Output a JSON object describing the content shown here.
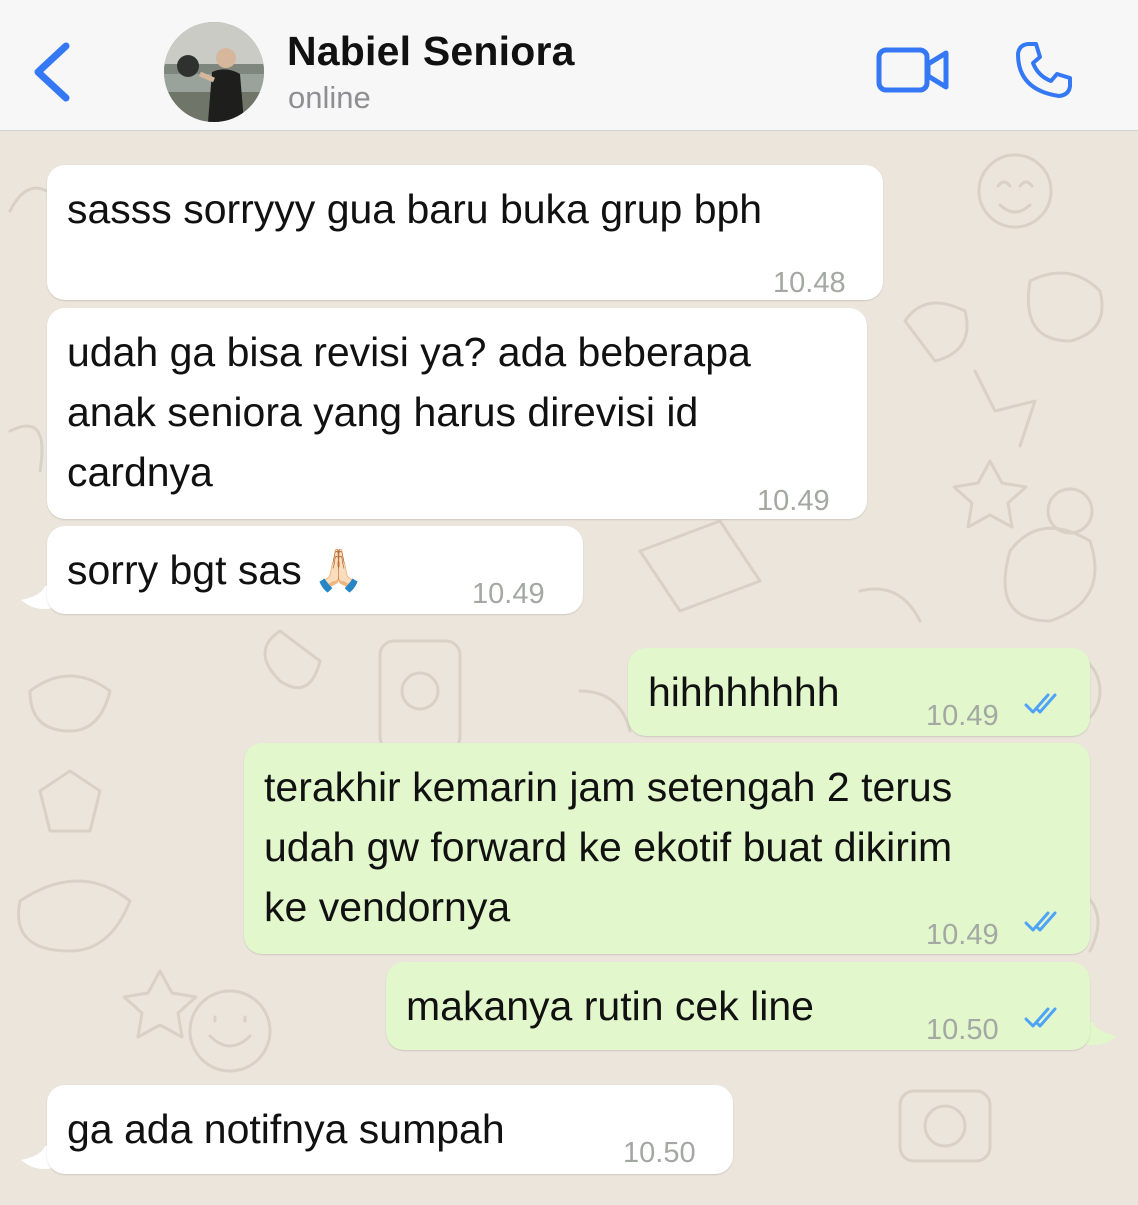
{
  "header": {
    "contact_name": "Nabiel Seniora",
    "status": "online",
    "icons": {
      "back": "chevron-left-icon",
      "video": "video-camera-icon",
      "call": "phone-icon"
    },
    "accent_color": "#3478f6"
  },
  "messages": [
    {
      "direction": "incoming",
      "lines": [
        "sasss sorryyy gua baru buka grup bph"
      ],
      "time": "10.48"
    },
    {
      "direction": "incoming",
      "lines": [
        "udah ga bisa revisi ya? ada beberapa",
        "anak seniora yang harus direvisi id",
        "cardnya"
      ],
      "time": "10.49"
    },
    {
      "direction": "incoming",
      "lines": [
        "sorry bgt sas 🙏🏻"
      ],
      "time": "10.49"
    },
    {
      "direction": "outgoing",
      "lines": [
        "hihhhhhhh"
      ],
      "time": "10.49",
      "read": true
    },
    {
      "direction": "outgoing",
      "lines": [
        "terakhir kemarin jam setengah 2 terus",
        "udah gw forward ke ekotif buat dikirim",
        "ke vendornya"
      ],
      "time": "10.49",
      "read": true
    },
    {
      "direction": "outgoing",
      "lines": [
        "makanya rutin cek line"
      ],
      "time": "10.50",
      "read": true
    },
    {
      "direction": "incoming",
      "lines": [
        "ga ada notifnya sumpah"
      ],
      "time": "10.50"
    }
  ],
  "colors": {
    "incoming_bubble": "#ffffff",
    "outgoing_bubble": "#e2f7cb",
    "read_ticks": "#4fa3f7",
    "wallpaper": "#ebe5dc"
  }
}
